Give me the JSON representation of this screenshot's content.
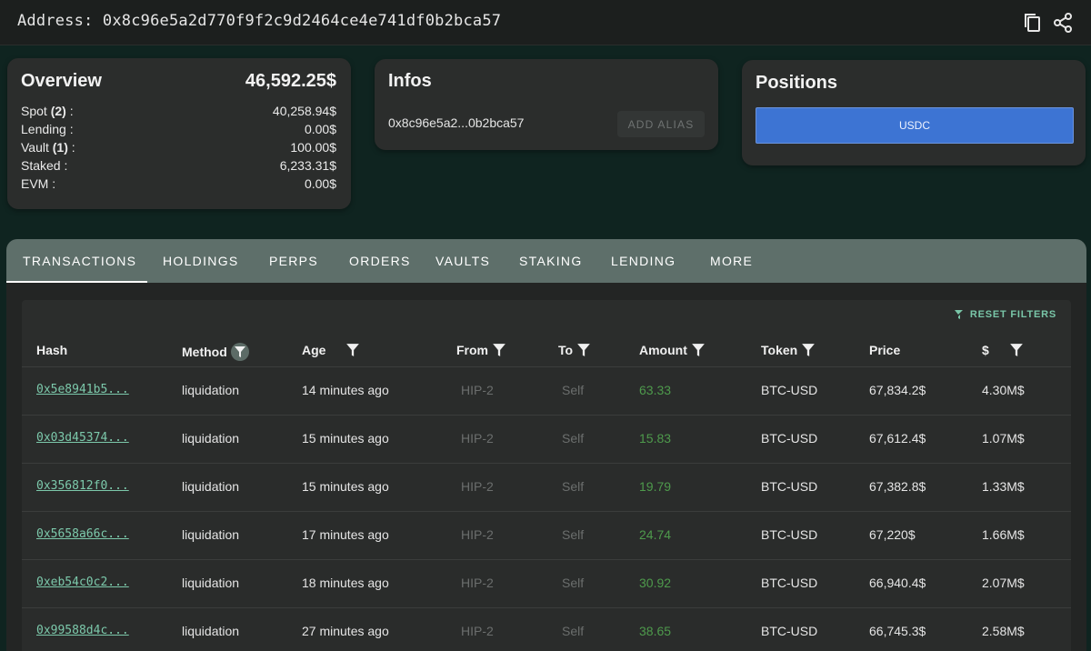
{
  "address": {
    "label": "Address:",
    "value": "0x8c96e5a2d770f9f2c9d2464ce4e741df0b2bca57",
    "icons": [
      "copy-icon",
      "share-icon"
    ]
  },
  "overview": {
    "title": "Overview",
    "total": "46,592.25$",
    "rows": [
      {
        "label": "Spot",
        "count": "(2)",
        "value": "40,258.94$"
      },
      {
        "label": "Lending",
        "count": "",
        "value": "0.00$"
      },
      {
        "label": "Vault",
        "count": "(1)",
        "value": "100.00$"
      },
      {
        "label": "Staked",
        "count": "",
        "value": "6,233.31$"
      },
      {
        "label": "EVM",
        "count": "",
        "value": "0.00$"
      }
    ]
  },
  "infos": {
    "title": "Infos",
    "short_address": "0x8c96e5a2...0b2bca57",
    "add_alias_label": "ADD ALIAS"
  },
  "positions": {
    "title": "Positions",
    "bars": [
      {
        "label": "USDC",
        "share": 1.0,
        "color": "#3d74d3"
      }
    ]
  },
  "tabs": [
    {
      "label": "TRANSACTIONS",
      "active": true
    },
    {
      "label": "HOLDINGS",
      "active": false
    },
    {
      "label": "PERPS",
      "active": false
    },
    {
      "label": "ORDERS",
      "active": false
    },
    {
      "label": "VAULTS",
      "active": false
    },
    {
      "label": "STAKING",
      "active": false
    },
    {
      "label": "LENDING",
      "active": false
    },
    {
      "label": "MORE",
      "active": false
    }
  ],
  "table": {
    "reset_filters_label": "RESET FILTERS",
    "columns": [
      "Hash",
      "Method",
      "Age",
      "From",
      "To",
      "Amount",
      "Token",
      "Price",
      "$"
    ],
    "rows": [
      {
        "hash": "0x5e8941b5...",
        "method": "liquidation",
        "age": "14 minutes ago",
        "from": "HIP-2",
        "to": "Self",
        "amount": "63.33",
        "token": "BTC-USD",
        "price": "67,834.2$",
        "usd": "4.30M$"
      },
      {
        "hash": "0x03d45374...",
        "method": "liquidation",
        "age": "15 minutes ago",
        "from": "HIP-2",
        "to": "Self",
        "amount": "15.83",
        "token": "BTC-USD",
        "price": "67,612.4$",
        "usd": "1.07M$"
      },
      {
        "hash": "0x356812f0...",
        "method": "liquidation",
        "age": "15 minutes ago",
        "from": "HIP-2",
        "to": "Self",
        "amount": "19.79",
        "token": "BTC-USD",
        "price": "67,382.8$",
        "usd": "1.33M$"
      },
      {
        "hash": "0x5658a66c...",
        "method": "liquidation",
        "age": "17 minutes ago",
        "from": "HIP-2",
        "to": "Self",
        "amount": "24.74",
        "token": "BTC-USD",
        "price": "67,220$",
        "usd": "1.66M$"
      },
      {
        "hash": "0xeb54c0c2...",
        "method": "liquidation",
        "age": "18 minutes ago",
        "from": "HIP-2",
        "to": "Self",
        "amount": "30.92",
        "token": "BTC-USD",
        "price": "66,940.4$",
        "usd": "2.07M$"
      },
      {
        "hash": "0x99588d4c...",
        "method": "liquidation",
        "age": "27 minutes ago",
        "from": "HIP-2",
        "to": "Self",
        "amount": "38.65",
        "token": "BTC-USD",
        "price": "66,745.3$",
        "usd": "2.58M$"
      }
    ]
  }
}
